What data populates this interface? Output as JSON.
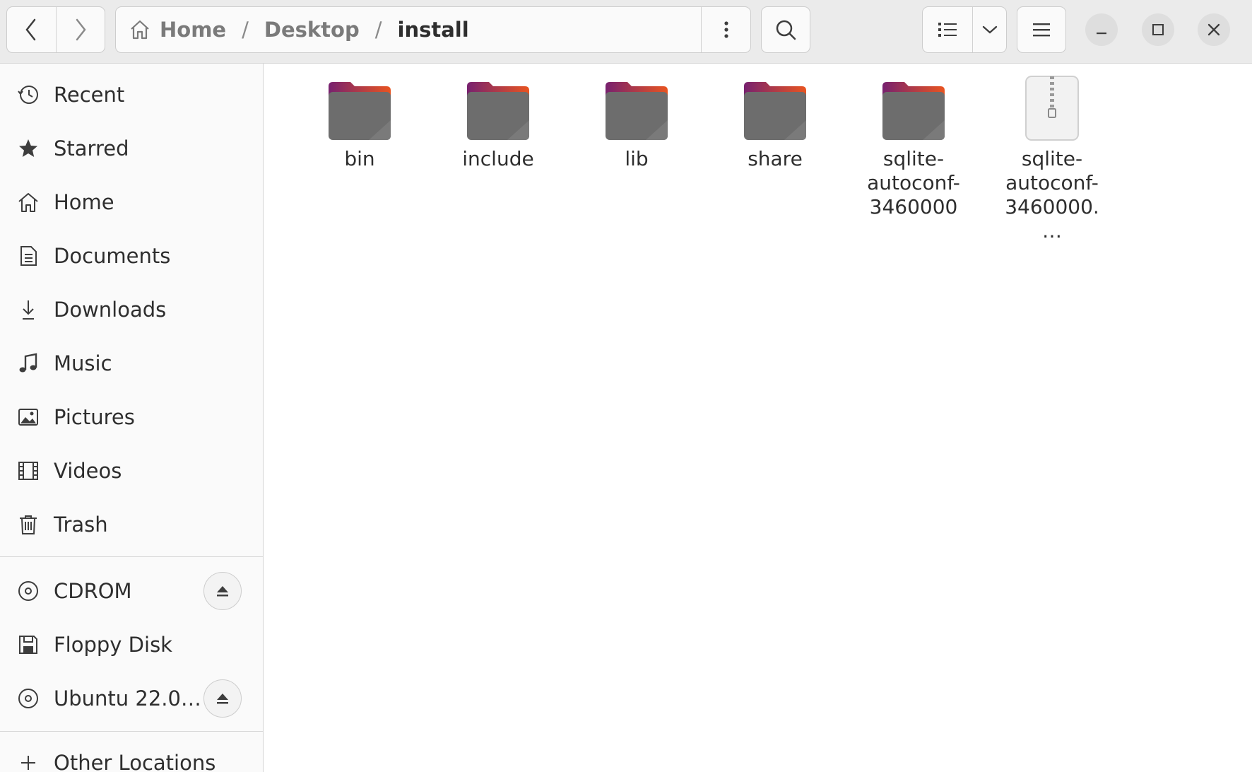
{
  "header": {
    "path": [
      "Home",
      "Desktop",
      "install"
    ]
  },
  "sidebar": {
    "places": [
      {
        "label": "Recent",
        "icon": "clock-icon"
      },
      {
        "label": "Starred",
        "icon": "star-icon"
      },
      {
        "label": "Home",
        "icon": "home-icon"
      },
      {
        "label": "Documents",
        "icon": "document-icon"
      },
      {
        "label": "Downloads",
        "icon": "download-icon"
      },
      {
        "label": "Music",
        "icon": "music-icon"
      },
      {
        "label": "Pictures",
        "icon": "picture-icon"
      },
      {
        "label": "Videos",
        "icon": "film-icon"
      },
      {
        "label": "Trash",
        "icon": "trash-icon"
      }
    ],
    "devices": [
      {
        "label": "CDROM",
        "icon": "disc-icon",
        "ejectable": true
      },
      {
        "label": "Floppy Disk",
        "icon": "floppy-icon",
        "ejectable": false
      },
      {
        "label": "Ubuntu 22.0…",
        "icon": "disc-icon",
        "ejectable": true
      }
    ],
    "other": {
      "label": "Other Locations",
      "icon": "plus-icon"
    }
  },
  "files": [
    {
      "name": "bin",
      "type": "folder"
    },
    {
      "name": "include",
      "type": "folder"
    },
    {
      "name": "lib",
      "type": "folder"
    },
    {
      "name": "share",
      "type": "folder"
    },
    {
      "name": "sqlite-autoconf-3460000",
      "type": "folder"
    },
    {
      "name": "sqlite-autoconf-3460000.…",
      "type": "archive"
    }
  ],
  "colors": {
    "folder_top": "#e95420",
    "folder_top_dark": "#77216f",
    "folder_body": "#6d6d6d",
    "accent": "#e95420"
  }
}
